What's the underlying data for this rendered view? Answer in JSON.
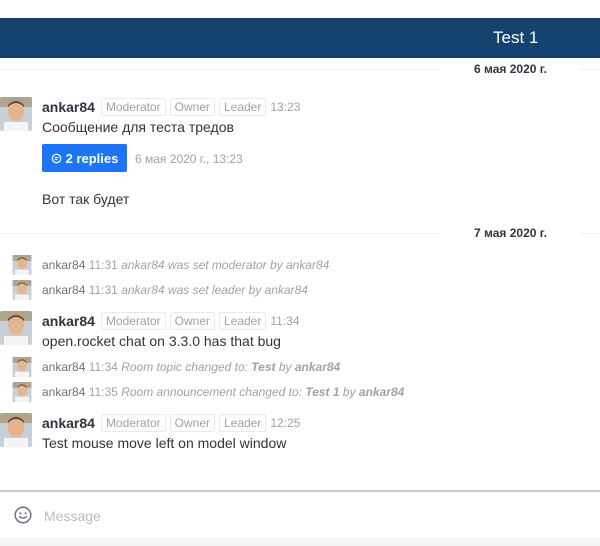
{
  "header": {
    "title": "Test 1"
  },
  "dividers": [
    "6 мая 2020 г.",
    "7 мая 2020 г."
  ],
  "roles": [
    "Moderator",
    "Owner",
    "Leader"
  ],
  "messages": {
    "m1": {
      "user": "ankar84",
      "time": "13:23",
      "text": "Сообщение для теста тредов"
    },
    "thread": {
      "replies_label": "2 replies",
      "last_reply": "6 мая 2020 г., 13:23",
      "icon": "thread-icon"
    },
    "m2": {
      "text": "Вот так будет"
    },
    "m3": {
      "user": "ankar84",
      "time": "11:34",
      "text": "open.rocket chat on 3.3.0 has that bug"
    },
    "m4": {
      "user": "ankar84",
      "time": "12:25",
      "text": "Test mouse move left on model window"
    }
  },
  "system": {
    "s1": {
      "user": "ankar84",
      "time": "11:31",
      "pre": "ankar84 was set moderator by ankar84"
    },
    "s2": {
      "user": "ankar84",
      "time": "11:31",
      "pre": "ankar84 was set leader by ankar84"
    },
    "s3": {
      "user": "ankar84",
      "time": "11:34",
      "pre": "Room topic changed to: ",
      "bold1": "Test",
      "mid": " by ",
      "bold2": "ankar84"
    },
    "s4": {
      "user": "ankar84",
      "time": "11:35",
      "pre": "Room announcement changed to: ",
      "bold1": "Test 1",
      "mid": " by ",
      "bold2": "ankar84"
    }
  },
  "composer": {
    "placeholder": "Message",
    "icon": "emoji-icon"
  },
  "colors": {
    "header_bg": "#13446f",
    "accent": "#1d74f5"
  }
}
